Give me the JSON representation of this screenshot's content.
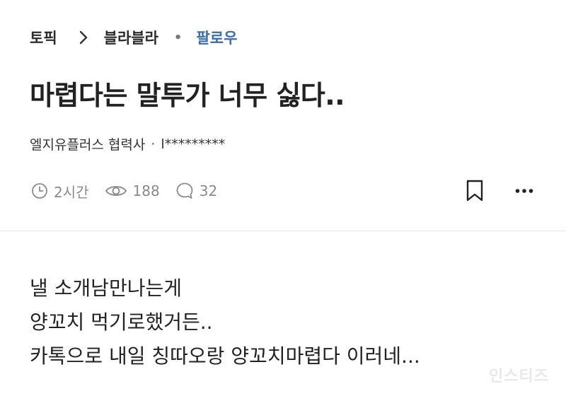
{
  "breadcrumb": {
    "topic": "토픽",
    "board": "블라블라",
    "follow": "팔로우"
  },
  "post": {
    "title": "마렵다는 말투가 너무 싫다..",
    "company": "엘지유플러스 협력사",
    "author": "l*********",
    "time": "2시간",
    "views": "188",
    "comments": "32",
    "body": [
      "낼 소개남만나는게",
      "양꼬치 먹기로했거든..",
      "카톡으로 내일 칭따오랑 양꼬치마렵다 이러네..."
    ]
  },
  "watermark": "인스티즈",
  "icons": {
    "breadcrumb_separator": "chevron-right-icon",
    "time": "clock-icon",
    "views": "eye-icon",
    "comments": "comment-icon",
    "bookmark": "bookmark-icon",
    "more": "more-horizontal-icon"
  }
}
